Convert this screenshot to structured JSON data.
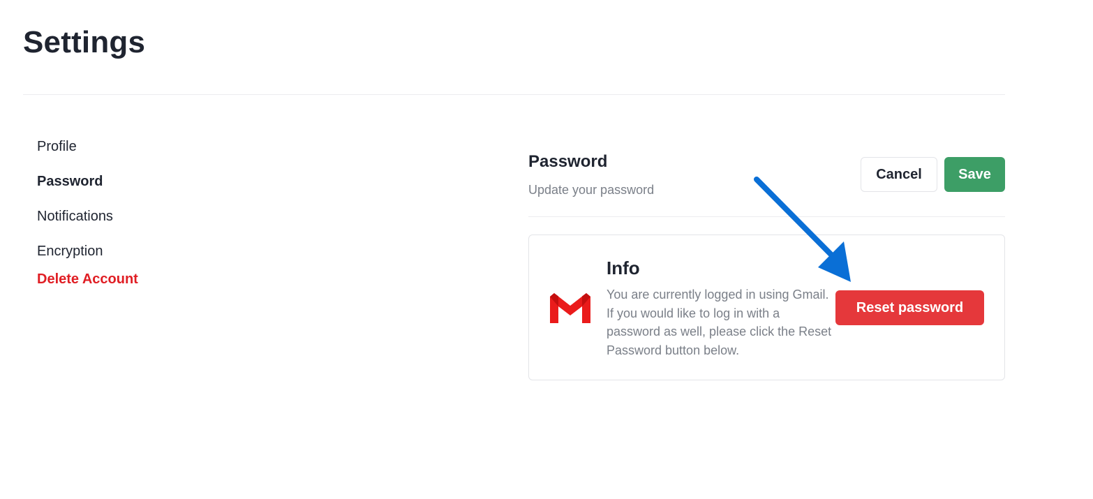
{
  "page": {
    "title": "Settings"
  },
  "sidebar": {
    "items": [
      {
        "label": "Profile",
        "state": "normal"
      },
      {
        "label": "Password",
        "state": "active"
      },
      {
        "label": "Notifications",
        "state": "normal"
      },
      {
        "label": "Encryption",
        "state": "normal"
      },
      {
        "label": "Delete Account",
        "state": "danger"
      }
    ]
  },
  "section": {
    "title": "Password",
    "subtitle": "Update your password",
    "cancel_label": "Cancel",
    "save_label": "Save"
  },
  "info_card": {
    "icon": "gmail-icon",
    "title": "Info",
    "text": "You are currently logged in using Gmail. If you would like to log in with a password as well, please click the Reset Password button below.",
    "reset_label": "Reset password"
  },
  "colors": {
    "save": "#3d9e66",
    "reset": "#e5383b",
    "danger_text": "#e01e24",
    "annotation_arrow": "#0a6fd6",
    "gmail_red": "#ea1b1b"
  }
}
